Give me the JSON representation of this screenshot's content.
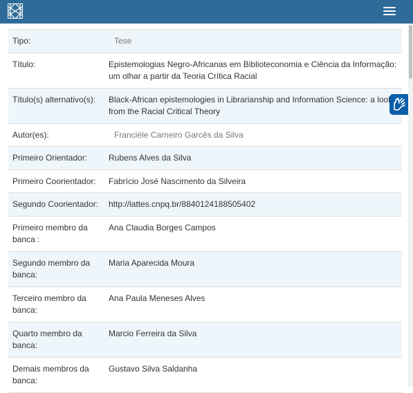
{
  "header": {
    "menu_icon": "hamburger-menu-icon",
    "logo_icon": "repository-logo-icon",
    "accessibility_icon": "sign-language-hands-icon"
  },
  "colors": {
    "header_bg": "#2f6b99",
    "row_stripe": "#eef6fb",
    "accessibility_bg": "#0b5ea8"
  },
  "rows": [
    {
      "label": "Tipo:",
      "value": "Tese"
    },
    {
      "label": "Título:",
      "value": "Epistemologias Negro-Africanas em Biblioteconomia e Ciência da Informação: um olhar a partir da Teoria Crítica Racial"
    },
    {
      "label": "Título(s) alternativo(s):",
      "value": "Black-African epistemologies in Librarianship and Information Science: a look from the Racial Critical Theory"
    },
    {
      "label": "Autor(es):",
      "value": "Franciéle Carneiro Garcês da Silva"
    },
    {
      "label": "Primeiro Orientador:",
      "value": "Rubens Alves da Silva"
    },
    {
      "label": "Primeiro Coorientador:",
      "value": "Fabrício José Nascimento da Silveira"
    },
    {
      "label": "Segundo Coorientador:",
      "value": "http://lattes.cnpq.br/8840124188505402"
    },
    {
      "label": "Primeiro membro da banca :",
      "value": "Ana Claudia Borges Campos"
    },
    {
      "label": "Segundo membro da banca:",
      "value": "Maria Aparecida Moura"
    },
    {
      "label": "Terceiro membro da banca:",
      "value": "Ana Paula Meneses Alves"
    },
    {
      "label": "Quarto membro da banca:",
      "value": "Marcio Ferreira da Silva"
    },
    {
      "label": "Demais membros da banca:",
      "value": "Gustavo Silva Saldanha"
    }
  ]
}
